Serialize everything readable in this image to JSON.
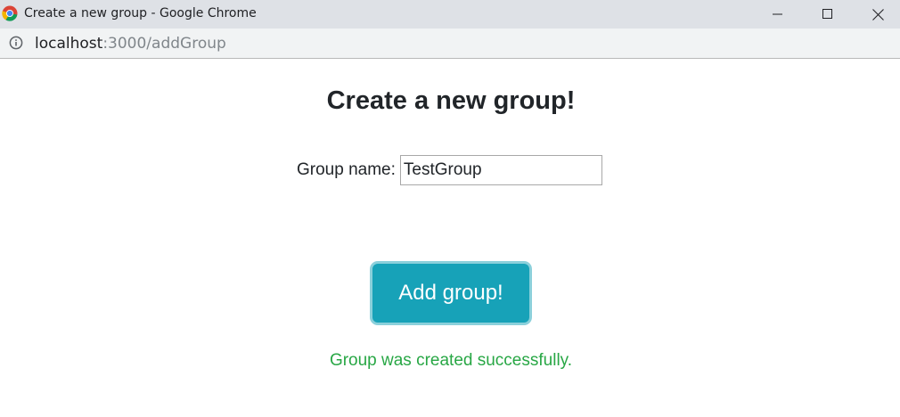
{
  "window": {
    "title": "Create a new group - Google Chrome",
    "minimize_icon": "minimize-icon",
    "maximize_icon": "maximize-icon",
    "close_icon": "close-icon"
  },
  "address_bar": {
    "host": "localhost",
    "rest": ":3000/addGroup",
    "info_icon": "info-icon"
  },
  "page": {
    "title": "Create a new group!",
    "form": {
      "label": "Group name:",
      "input_value": "TestGroup"
    },
    "submit_label": "Add group!",
    "status_message": "Group was created successfully."
  },
  "colors": {
    "titlebar_bg": "#dee1e6",
    "button_bg": "#17a2b8",
    "success_text": "#28a745"
  }
}
